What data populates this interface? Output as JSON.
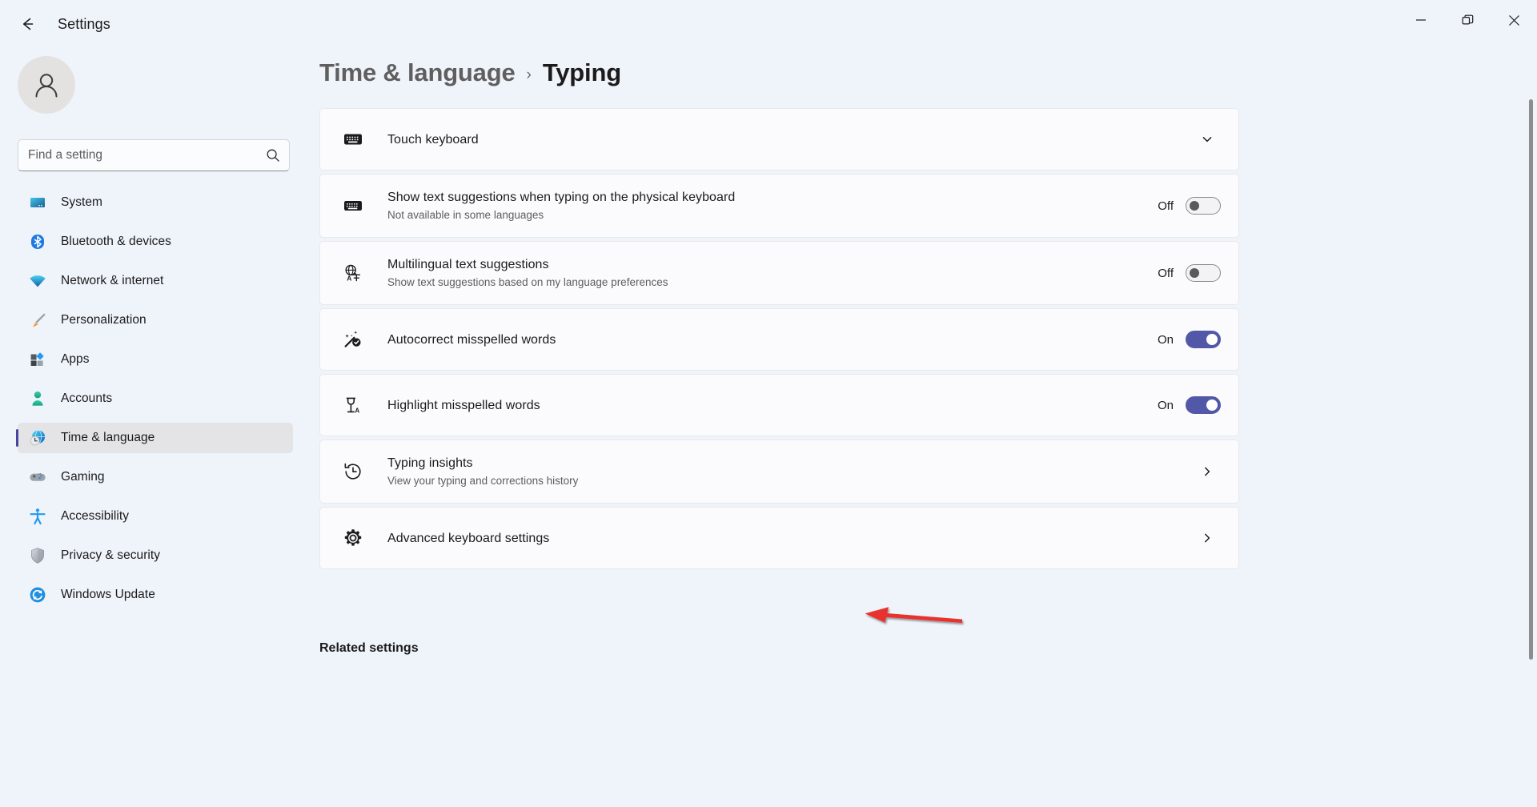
{
  "window": {
    "app_title": "Settings",
    "back_icon": "back-arrow-icon",
    "controls": {
      "minimize": "minimize-icon",
      "restore": "restore-icon",
      "close": "close-icon"
    }
  },
  "sidebar": {
    "avatar_icon": "person-avatar-icon",
    "search": {
      "placeholder": "Find a setting",
      "value": "",
      "icon": "search-icon"
    },
    "items": [
      {
        "label": "System",
        "icon": "monitor-icon",
        "selected": false
      },
      {
        "label": "Bluetooth & devices",
        "icon": "bluetooth-icon",
        "selected": false
      },
      {
        "label": "Network & internet",
        "icon": "wifi-icon",
        "selected": false
      },
      {
        "label": "Personalization",
        "icon": "paintbrush-icon",
        "selected": false
      },
      {
        "label": "Apps",
        "icon": "apps-icon",
        "selected": false
      },
      {
        "label": "Accounts",
        "icon": "account-icon",
        "selected": false
      },
      {
        "label": "Time & language",
        "icon": "clock-globe-icon",
        "selected": true
      },
      {
        "label": "Gaming",
        "icon": "gamepad-icon",
        "selected": false
      },
      {
        "label": "Accessibility",
        "icon": "accessibility-icon",
        "selected": false
      },
      {
        "label": "Privacy & security",
        "icon": "shield-icon",
        "selected": false
      },
      {
        "label": "Windows Update",
        "icon": "update-icon",
        "selected": false
      }
    ]
  },
  "header": {
    "breadcrumb_parent": "Time & language",
    "breadcrumb_separator": "›",
    "breadcrumb_current": "Typing"
  },
  "main": {
    "rows": [
      {
        "title": "Touch keyboard",
        "subtitle": "",
        "icon": "touch-keyboard-icon",
        "control": "chevron-down",
        "toggle_label": ""
      },
      {
        "title": "Show text suggestions when typing on the physical keyboard",
        "subtitle": "Not available in some languages",
        "icon": "keyboard-icon",
        "control": "toggle-off",
        "toggle_label": "Off"
      },
      {
        "title": "Multilingual text suggestions",
        "subtitle": "Show text suggestions based on my language preferences",
        "icon": "multilingual-icon",
        "control": "toggle-off",
        "toggle_label": "Off"
      },
      {
        "title": "Autocorrect misspelled words",
        "subtitle": "",
        "icon": "magic-wand-check-icon",
        "control": "toggle-on",
        "toggle_label": "On"
      },
      {
        "title": "Highlight misspelled words",
        "subtitle": "",
        "icon": "highlighter-icon",
        "control": "toggle-on",
        "toggle_label": "On"
      },
      {
        "title": "Typing insights",
        "subtitle": "View your typing and corrections history",
        "icon": "history-clock-icon",
        "control": "chevron-right",
        "toggle_label": ""
      },
      {
        "title": "Advanced keyboard settings",
        "subtitle": "",
        "icon": "gear-icon",
        "control": "chevron-right",
        "toggle_label": ""
      }
    ],
    "related_settings_heading": "Related settings"
  },
  "annotation": {
    "type": "red-arrow",
    "points_to": "Advanced keyboard settings",
    "color": "#e8332f"
  },
  "colors": {
    "page_background": "#eff3fa",
    "card_background": "#fbfbfd",
    "card_border": "#e8e9ec",
    "accent_toggle_on": "#5258a8",
    "selected_nav_indicator": "#4646a0",
    "selected_nav_background": "#e4e4e6",
    "annotation_red": "#e8332f"
  }
}
